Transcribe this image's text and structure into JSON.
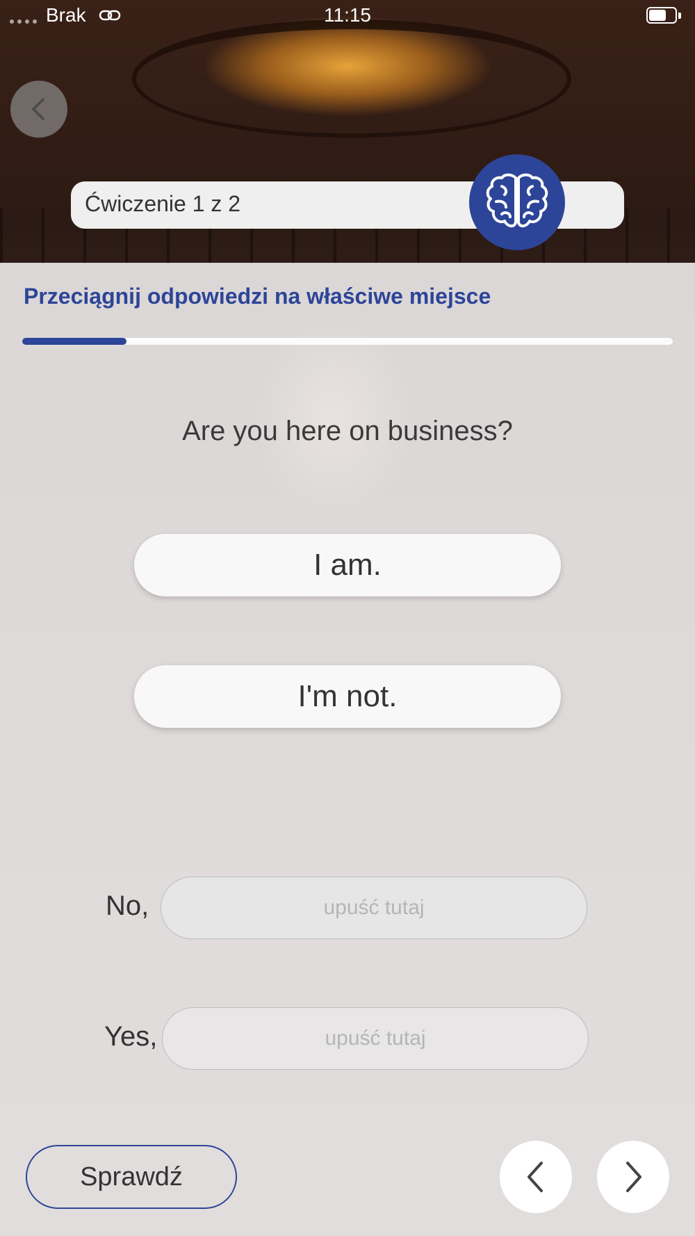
{
  "status_bar": {
    "carrier": "Brak",
    "time": "11:15",
    "icons": [
      "signal-dots-icon",
      "link-icon",
      "battery-icon"
    ]
  },
  "header": {
    "back_icon": "chevron-left-icon",
    "exercise_label": "Ćwiczenie 1 z 2",
    "badge_icon": "brain-icon",
    "accent_color": "#2d4598"
  },
  "exercise": {
    "instruction": "Przeciągnij odpowiedzi na właściwe miejsce",
    "progress": 0.16,
    "question": "Are you here on business?",
    "answers": [
      "I am.",
      "I'm not."
    ],
    "drop_rows": [
      {
        "prefix": "No,",
        "placeholder": "upuść tutaj"
      },
      {
        "prefix": "Yes,",
        "placeholder": "upuść tutaj"
      }
    ]
  },
  "footer": {
    "check_label": "Sprawdź",
    "prev_icon": "chevron-left-icon",
    "next_icon": "chevron-right-icon"
  }
}
